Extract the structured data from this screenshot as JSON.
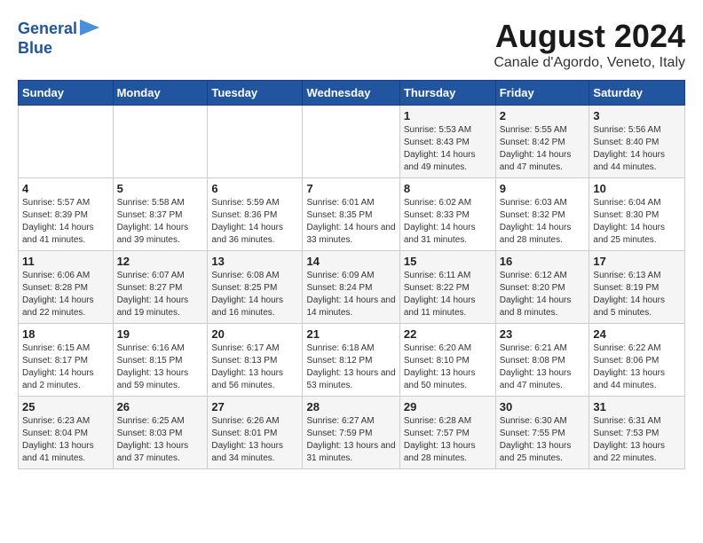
{
  "logo": {
    "line1": "General",
    "line2": "Blue"
  },
  "title": "August 2024",
  "location": "Canale d'Agordo, Veneto, Italy",
  "days_of_week": [
    "Sunday",
    "Monday",
    "Tuesday",
    "Wednesday",
    "Thursday",
    "Friday",
    "Saturday"
  ],
  "weeks": [
    [
      {
        "day": "",
        "info": ""
      },
      {
        "day": "",
        "info": ""
      },
      {
        "day": "",
        "info": ""
      },
      {
        "day": "",
        "info": ""
      },
      {
        "day": "1",
        "info": "Sunrise: 5:53 AM\nSunset: 8:43 PM\nDaylight: 14 hours and 49 minutes."
      },
      {
        "day": "2",
        "info": "Sunrise: 5:55 AM\nSunset: 8:42 PM\nDaylight: 14 hours and 47 minutes."
      },
      {
        "day": "3",
        "info": "Sunrise: 5:56 AM\nSunset: 8:40 PM\nDaylight: 14 hours and 44 minutes."
      }
    ],
    [
      {
        "day": "4",
        "info": "Sunrise: 5:57 AM\nSunset: 8:39 PM\nDaylight: 14 hours and 41 minutes."
      },
      {
        "day": "5",
        "info": "Sunrise: 5:58 AM\nSunset: 8:37 PM\nDaylight: 14 hours and 39 minutes."
      },
      {
        "day": "6",
        "info": "Sunrise: 5:59 AM\nSunset: 8:36 PM\nDaylight: 14 hours and 36 minutes."
      },
      {
        "day": "7",
        "info": "Sunrise: 6:01 AM\nSunset: 8:35 PM\nDaylight: 14 hours and 33 minutes."
      },
      {
        "day": "8",
        "info": "Sunrise: 6:02 AM\nSunset: 8:33 PM\nDaylight: 14 hours and 31 minutes."
      },
      {
        "day": "9",
        "info": "Sunrise: 6:03 AM\nSunset: 8:32 PM\nDaylight: 14 hours and 28 minutes."
      },
      {
        "day": "10",
        "info": "Sunrise: 6:04 AM\nSunset: 8:30 PM\nDaylight: 14 hours and 25 minutes."
      }
    ],
    [
      {
        "day": "11",
        "info": "Sunrise: 6:06 AM\nSunset: 8:28 PM\nDaylight: 14 hours and 22 minutes."
      },
      {
        "day": "12",
        "info": "Sunrise: 6:07 AM\nSunset: 8:27 PM\nDaylight: 14 hours and 19 minutes."
      },
      {
        "day": "13",
        "info": "Sunrise: 6:08 AM\nSunset: 8:25 PM\nDaylight: 14 hours and 16 minutes."
      },
      {
        "day": "14",
        "info": "Sunrise: 6:09 AM\nSunset: 8:24 PM\nDaylight: 14 hours and 14 minutes."
      },
      {
        "day": "15",
        "info": "Sunrise: 6:11 AM\nSunset: 8:22 PM\nDaylight: 14 hours and 11 minutes."
      },
      {
        "day": "16",
        "info": "Sunrise: 6:12 AM\nSunset: 8:20 PM\nDaylight: 14 hours and 8 minutes."
      },
      {
        "day": "17",
        "info": "Sunrise: 6:13 AM\nSunset: 8:19 PM\nDaylight: 14 hours and 5 minutes."
      }
    ],
    [
      {
        "day": "18",
        "info": "Sunrise: 6:15 AM\nSunset: 8:17 PM\nDaylight: 14 hours and 2 minutes."
      },
      {
        "day": "19",
        "info": "Sunrise: 6:16 AM\nSunset: 8:15 PM\nDaylight: 13 hours and 59 minutes."
      },
      {
        "day": "20",
        "info": "Sunrise: 6:17 AM\nSunset: 8:13 PM\nDaylight: 13 hours and 56 minutes."
      },
      {
        "day": "21",
        "info": "Sunrise: 6:18 AM\nSunset: 8:12 PM\nDaylight: 13 hours and 53 minutes."
      },
      {
        "day": "22",
        "info": "Sunrise: 6:20 AM\nSunset: 8:10 PM\nDaylight: 13 hours and 50 minutes."
      },
      {
        "day": "23",
        "info": "Sunrise: 6:21 AM\nSunset: 8:08 PM\nDaylight: 13 hours and 47 minutes."
      },
      {
        "day": "24",
        "info": "Sunrise: 6:22 AM\nSunset: 8:06 PM\nDaylight: 13 hours and 44 minutes."
      }
    ],
    [
      {
        "day": "25",
        "info": "Sunrise: 6:23 AM\nSunset: 8:04 PM\nDaylight: 13 hours and 41 minutes."
      },
      {
        "day": "26",
        "info": "Sunrise: 6:25 AM\nSunset: 8:03 PM\nDaylight: 13 hours and 37 minutes."
      },
      {
        "day": "27",
        "info": "Sunrise: 6:26 AM\nSunset: 8:01 PM\nDaylight: 13 hours and 34 minutes."
      },
      {
        "day": "28",
        "info": "Sunrise: 6:27 AM\nSunset: 7:59 PM\nDaylight: 13 hours and 31 minutes."
      },
      {
        "day": "29",
        "info": "Sunrise: 6:28 AM\nSunset: 7:57 PM\nDaylight: 13 hours and 28 minutes."
      },
      {
        "day": "30",
        "info": "Sunrise: 6:30 AM\nSunset: 7:55 PM\nDaylight: 13 hours and 25 minutes."
      },
      {
        "day": "31",
        "info": "Sunrise: 6:31 AM\nSunset: 7:53 PM\nDaylight: 13 hours and 22 minutes."
      }
    ]
  ]
}
